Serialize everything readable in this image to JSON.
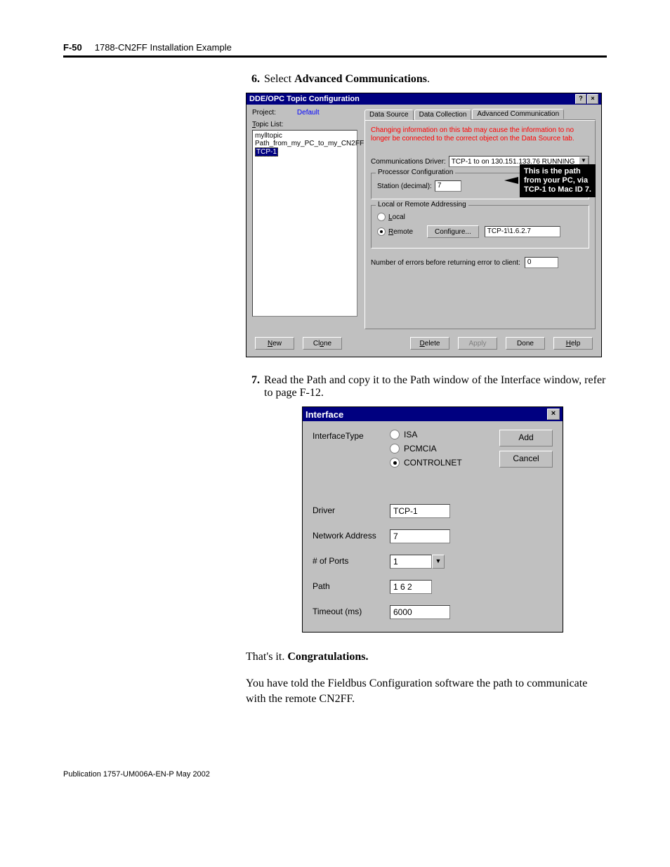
{
  "header": {
    "page_number": "F-50",
    "title": "1788-CN2FF Installation Example"
  },
  "step6": {
    "num": "6.",
    "text_prefix": "Select ",
    "text_bold": "Advanced Communications",
    "text_suffix": "."
  },
  "dialog1": {
    "title": "DDE/OPC Topic Configuration",
    "help_icon": "?",
    "close_icon": "×",
    "project_label": "Project:",
    "project_value": "Default",
    "topic_list_label": "Topic List:",
    "topic_items": [
      "mylltopic",
      "Path_from_my_PC_to_my_CN2FF"
    ],
    "topic_selected": "TCP-1",
    "tabs": [
      "Data Source",
      "Data Collection",
      "Advanced Communication"
    ],
    "warning": "Changing information on this tab may cause the information to no longer be connected to the correct object on the Data Source tab.",
    "comm_driver_label": "Communications Driver:",
    "comm_driver_value": "TCP-1 to  on 130.151.133.76 RUNNING",
    "procconf_legend": "Processor Configuration",
    "station_label": "Station (decimal):",
    "station_value": "7",
    "addr_legend": "Local or Remote Addressing",
    "radio_local": "Local",
    "radio_remote": "Remote",
    "configure_btn": "Configure...",
    "remote_path_value": "TCP-1\\1.6.2.7",
    "errors_label": "Number of errors before returning error to client:",
    "errors_value": "0",
    "buttons": {
      "new": "New",
      "clone": "Clone",
      "delete": "Delete",
      "apply": "Apply",
      "done": "Done",
      "help": "Help"
    },
    "callout": {
      "line1": "This is the path",
      "line2": "from your PC, via",
      "line3": "TCP-1 to Mac ID 7."
    }
  },
  "step7": {
    "num": "7.",
    "text": "Read the Path and copy it to the Path window of the Interface window, refer to page F-12."
  },
  "dialog2": {
    "title": "Interface",
    "close_icon": "×",
    "interface_type_label": "InterfaceType",
    "radios": {
      "isa": "ISA",
      "pcmcia": "PCMCIA",
      "controlnet": "CONTROLNET"
    },
    "add_btn": "Add",
    "cancel_btn": "Cancel",
    "driver_label": "Driver",
    "driver_value": "TCP-1",
    "network_label": "Network Address",
    "network_value": "7",
    "ports_label": "# of Ports",
    "ports_value": "1",
    "path_label": "Path",
    "path_value": "1 6 2",
    "timeout_label": "Timeout (ms)",
    "timeout_value": "6000"
  },
  "closing": {
    "p1_prefix": "That's it. ",
    "p1_bold": "Congratulations.",
    "p2": "You have told the Fieldbus Configuration software the path to communicate with the remote CN2FF."
  },
  "footer": "Publication 1757-UM006A-EN-P May 2002"
}
